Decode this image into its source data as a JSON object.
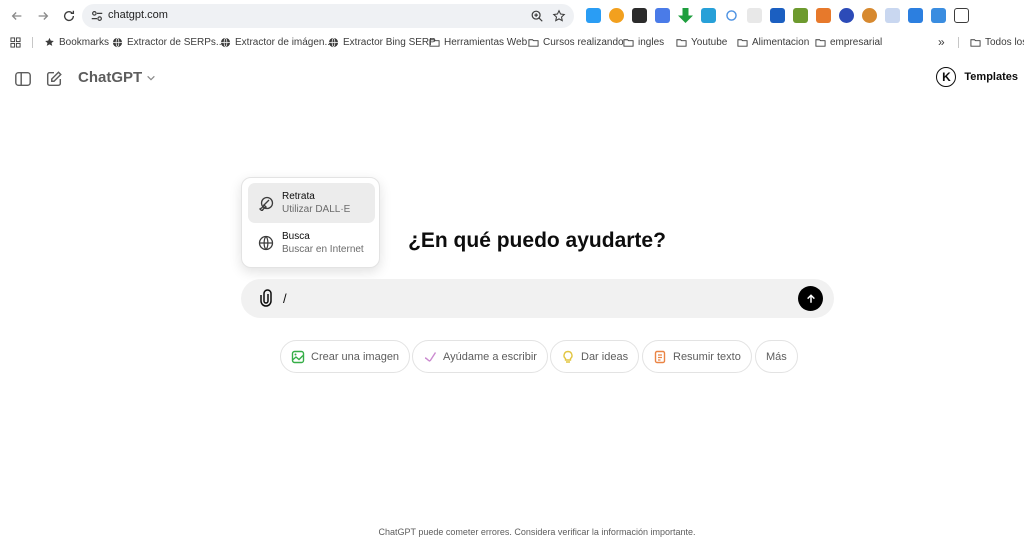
{
  "browser": {
    "url": "chatgpt.com",
    "bookmarks": [
      {
        "label": "Bookmarks",
        "icon": "star-icon"
      },
      {
        "label": "Extractor de SERPs...",
        "icon": "globe-icon"
      },
      {
        "label": "Extractor de imágen...",
        "icon": "globe-icon"
      },
      {
        "label": "Extractor Bing SERP",
        "icon": "globe-icon"
      },
      {
        "label": "Herramientas Web",
        "icon": "folder-icon"
      },
      {
        "label": "Cursos realizando",
        "icon": "folder-icon"
      },
      {
        "label": "ingles",
        "icon": "folder-icon"
      },
      {
        "label": "Youtube",
        "icon": "folder-icon"
      },
      {
        "label": "Alimentacion",
        "icon": "folder-icon"
      },
      {
        "label": "empresarial",
        "icon": "folder-icon"
      }
    ],
    "overflow_label": "»",
    "all_bookmarks_label": "Todos los"
  },
  "header": {
    "title": "ChatGPT",
    "templates_label": "Templates",
    "templates_logo": "K"
  },
  "main": {
    "headline": "¿En qué puedo ayudarte?",
    "composer_value": "/",
    "popup": [
      {
        "title": "Retrata",
        "subtitle": "Utilizar DALL·E",
        "icon": "dalle-brush-icon"
      },
      {
        "title": "Busca",
        "subtitle": "Buscar en Internet",
        "icon": "globe-icon"
      }
    ],
    "chips": [
      {
        "label": "Crear una imagen",
        "icon": "image-icon",
        "color": "#35ae47"
      },
      {
        "label": "Ayúdame a escribir",
        "icon": "pen-icon",
        "color": "#cb8bd0"
      },
      {
        "label": "Dar ideas",
        "icon": "lightbulb-icon",
        "color": "#e2c541"
      },
      {
        "label": "Resumir texto",
        "icon": "document-icon",
        "color": "#ea8444"
      },
      {
        "label": "Más",
        "icon": "",
        "color": "#5d5d5d"
      }
    ]
  },
  "footer": {
    "disclaimer": "ChatGPT puede cometer errores. Considera verificar la información importante."
  },
  "colors": {
    "accent": "#000000",
    "composer_bg": "#f1f1f1",
    "url_bar_bg": "#eff1f4"
  }
}
